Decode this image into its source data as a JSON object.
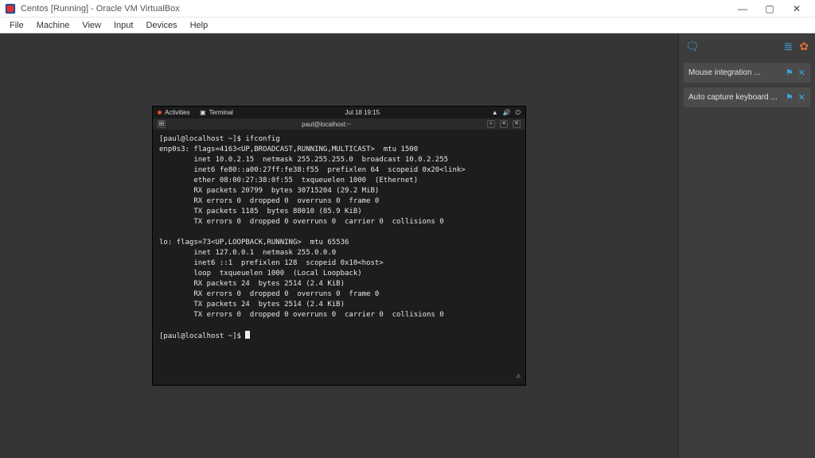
{
  "window": {
    "title": "Centos [Running] - Oracle VM VirtualBox",
    "controls": {
      "min": "—",
      "max": "▢",
      "close": "✕"
    }
  },
  "menu": {
    "file": "File",
    "machine": "Machine",
    "view": "View",
    "input": "Input",
    "devices": "Devices",
    "help": "Help"
  },
  "notifications": {
    "item1": "Mouse integration ...",
    "item2": "Auto capture keyboard ..."
  },
  "gnome": {
    "activities": "Activities",
    "terminal_label": "Terminal",
    "clock": "Jul 18  19:15"
  },
  "termbar": {
    "title": "paul@localhost:~"
  },
  "terminal": {
    "prompt1": "[paul@localhost ~]$ ",
    "cmd": "ifconfig",
    "l01": "enp0s3: flags=4163<UP,BROADCAST,RUNNING,MULTICAST>  mtu 1500",
    "l02": "        inet 10.0.2.15  netmask 255.255.255.0  broadcast 10.0.2.255",
    "l03": "        inet6 fe80::a00:27ff:fe38:f55  prefixlen 64  scopeid 0x20<link>",
    "l04": "        ether 08:00:27:38:0f:55  txqueuelen 1000  (Ethernet)",
    "l05": "        RX packets 20799  bytes 30715204 (29.2 MiB)",
    "l06": "        RX errors 0  dropped 0  overruns 0  frame 0",
    "l07": "        TX packets 1185  bytes 88010 (85.9 KiB)",
    "l08": "        TX errors 0  dropped 0 overruns 0  carrier 0  collisions 0",
    "l09": "",
    "l10": "lo: flags=73<UP,LOOPBACK,RUNNING>  mtu 65536",
    "l11": "        inet 127.0.0.1  netmask 255.0.0.0",
    "l12": "        inet6 ::1  prefixlen 128  scopeid 0x10<host>",
    "l13": "        loop  txqueuelen 1000  (Local Loopback)",
    "l14": "        RX packets 24  bytes 2514 (2.4 KiB)",
    "l15": "        RX errors 0  dropped 0  overruns 0  frame 0",
    "l16": "        TX packets 24  bytes 2514 (2.4 KiB)",
    "l17": "        TX errors 0  dropped 0 overruns 0  carrier 0  collisions 0",
    "l18": "",
    "prompt2": "[paul@localhost ~]$ "
  }
}
